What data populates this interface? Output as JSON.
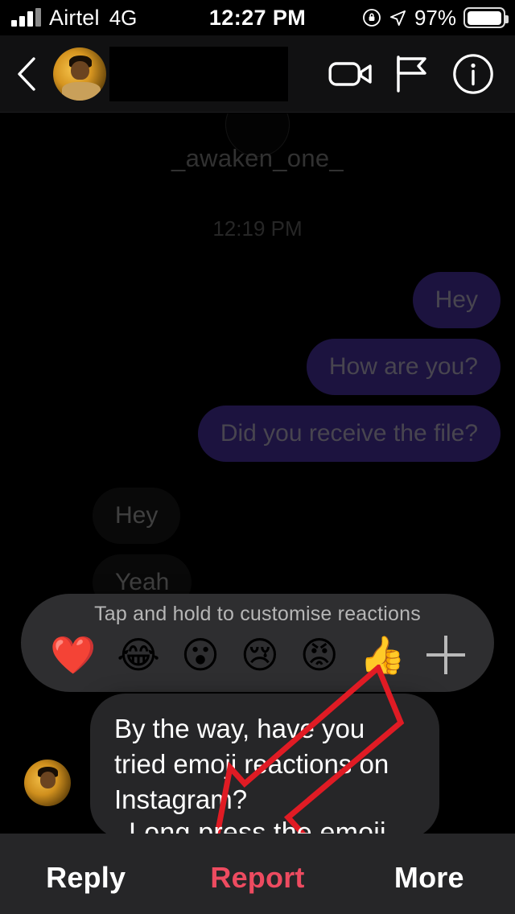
{
  "status_bar": {
    "carrier": "Airtel",
    "network": "4G",
    "time": "12:27 PM",
    "battery_percent": "97%",
    "signal_icon": "signal-bars-icon",
    "lock_icon": "orientation-lock-icon",
    "location_icon": "location-arrow-icon",
    "battery_icon": "battery-icon"
  },
  "header": {
    "back_icon": "back-chevron-icon",
    "avatar": "contact-avatar",
    "contact_name": "",
    "video_call_icon": "video-camera-icon",
    "flag_icon": "flag-icon",
    "info_icon": "info-circle-icon"
  },
  "thread": {
    "username": "_awaken_one_",
    "timestamp": "12:19 PM",
    "messages": [
      {
        "text": "Hey",
        "side": "out"
      },
      {
        "text": "How are you?",
        "side": "out"
      },
      {
        "text": "Did you receive the file?",
        "side": "out"
      },
      {
        "text": "Hey",
        "side": "in"
      },
      {
        "text": "Yeah",
        "side": "in"
      }
    ]
  },
  "reaction_bar": {
    "hint": "Tap and hold to customise reactions",
    "emojis": [
      {
        "glyph": "❤️",
        "name": "heart-reaction"
      },
      {
        "glyph": "😂",
        "name": "laughing-reaction"
      },
      {
        "glyph": "😮",
        "name": "surprised-reaction"
      },
      {
        "glyph": "😢",
        "name": "crying-reaction"
      },
      {
        "glyph": "😡",
        "name": "angry-reaction"
      },
      {
        "glyph": "👍",
        "name": "thumbs-up-reaction"
      }
    ],
    "plus_label": "+"
  },
  "focused_message": {
    "text": "By the way, have you tried emoji reactions on Instagram?"
  },
  "annotation": {
    "caption": "Long press the emoji",
    "arrow_color": "#e01b24"
  },
  "action_bar": {
    "items": [
      {
        "label": "Reply",
        "style": "normal"
      },
      {
        "label": "Report",
        "style": "danger"
      },
      {
        "label": "More",
        "style": "normal"
      }
    ]
  },
  "colors": {
    "outgoing_bubble": "#3e2b8c",
    "incoming_bubble": "#161616",
    "focused_bubble": "#262628",
    "report_red": "#ed4b60",
    "background": "#000000"
  }
}
